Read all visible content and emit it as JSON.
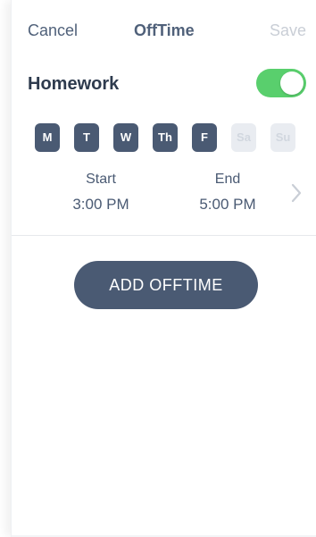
{
  "nav": {
    "cancel_label": "Cancel",
    "title": "OffTime",
    "save_label": "Save"
  },
  "schedule": {
    "name": "Homework",
    "enabled": true,
    "days": [
      {
        "label": "M",
        "active": true
      },
      {
        "label": "T",
        "active": true
      },
      {
        "label": "W",
        "active": true
      },
      {
        "label": "Th",
        "active": true
      },
      {
        "label": "F",
        "active": true
      },
      {
        "label": "Sa",
        "active": false
      },
      {
        "label": "Su",
        "active": false
      }
    ],
    "start_label": "Start",
    "start_time": "3:00 PM",
    "end_label": "End",
    "end_time": "5:00 PM"
  },
  "actions": {
    "add_offtime_label": "ADD OFFTIME"
  },
  "colors": {
    "accent": "#4a5a73",
    "toggle_on": "#59cf6d",
    "disabled_text": "#c9ced6",
    "day_off_bg": "#e9ecf1"
  }
}
